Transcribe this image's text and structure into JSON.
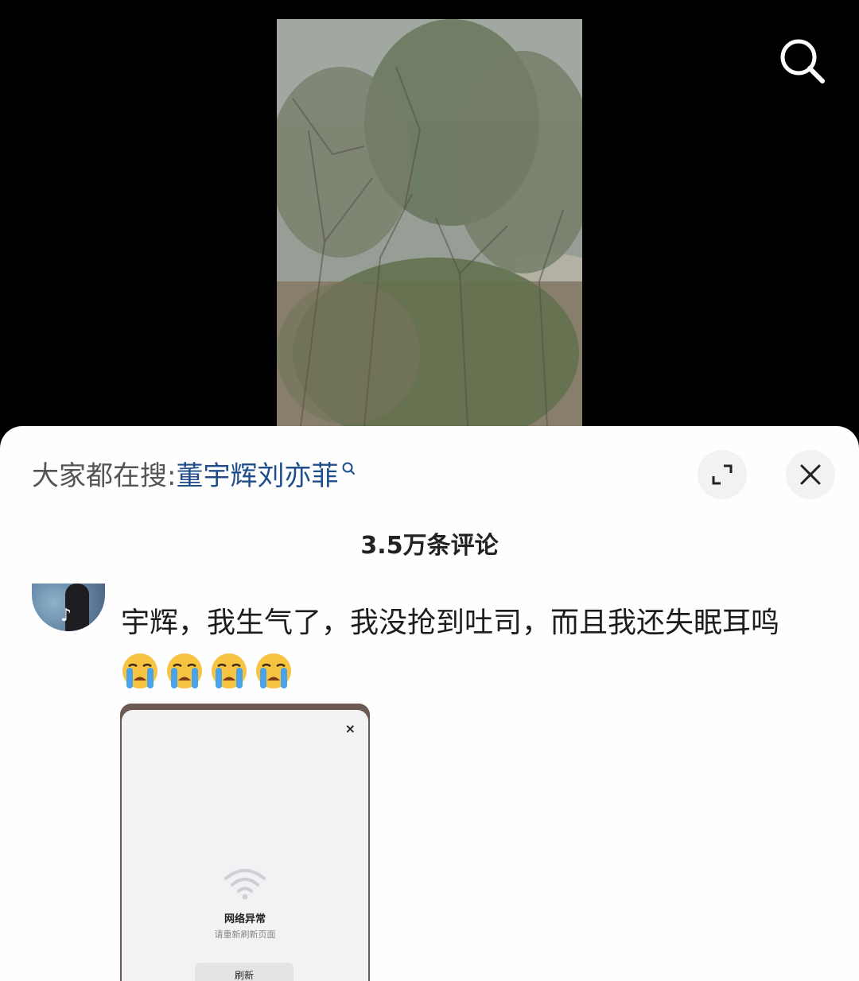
{
  "header": {
    "search_icon": "search-icon"
  },
  "sheet": {
    "trending_prefix": "大家都在搜",
    "trending_colon": ":",
    "trending_query": "董宇辉刘亦菲",
    "expand_icon": "expand-icon",
    "close_icon": "close-icon",
    "comment_count": "3.5万条评论"
  },
  "comment": {
    "text": "宇辉，我生气了，我没抢到吐司，而且我还失眠耳鸣",
    "emojis": [
      "crying-face",
      "crying-face",
      "crying-face",
      "crying-face"
    ],
    "attachment": {
      "close_glyph": "×",
      "title": "网络异常",
      "subtitle": "请重新刷新页面",
      "button": "刷新"
    }
  },
  "colors": {
    "link": "#1f4e8a",
    "background": "#000000",
    "sheet": "#fefefe"
  }
}
